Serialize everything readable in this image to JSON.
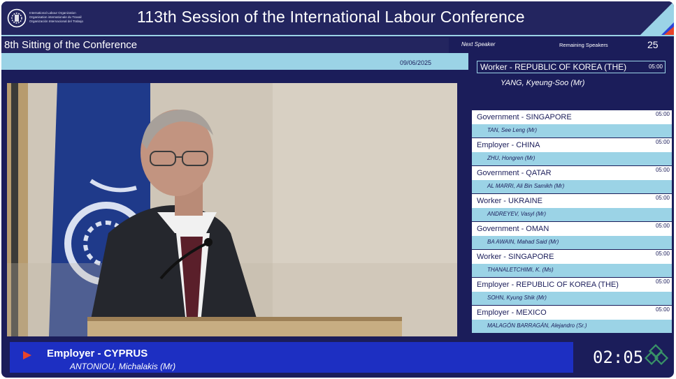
{
  "header": {
    "logo_lines": [
      "International Labour Organization",
      "Organisation internationale du Travail",
      "Organización Internacional del Trabajo"
    ],
    "title": "113th Session of the International Labour Conference"
  },
  "sitting": "8th Sitting of the Conference",
  "date": "09/06/2025",
  "next": {
    "label": "Next Speaker",
    "remaining_label": "Remaining Speakers",
    "remaining_count": "25",
    "country": "Worker - REPUBLIC OF KOREA (THE)",
    "time": "05:00",
    "name": "YANG, Kyeung-Soo (Mr)"
  },
  "speakers": [
    {
      "country": "Government - SINGAPORE",
      "name": "TAN, See Leng (Mr)",
      "time": "05:00"
    },
    {
      "country": "Employer - CHINA",
      "name": "ZHU, Hongren (Mr)",
      "time": "05:00"
    },
    {
      "country": "Government - QATAR",
      "name": "AL MARRI, Ali Bin Samikh (Mr)",
      "time": "05:00"
    },
    {
      "country": "Worker - UKRAINE",
      "name": "ANDREYEV, Vasyl (Mr)",
      "time": "05:00"
    },
    {
      "country": "Government - OMAN",
      "name": "BA AWAIN, Mahad Said (Mr)",
      "time": "05:00"
    },
    {
      "country": "Worker - SINGAPORE",
      "name": "THANALETCHIMI, K. (Ms)",
      "time": "05:00"
    },
    {
      "country": "Employer - REPUBLIC OF KOREA (THE)",
      "name": "SOHN, Kyung Shik (Mr)",
      "time": "05:00"
    },
    {
      "country": "Employer - MEXICO",
      "name": "MALAGÓN BARRAGÁN, Alejandro (Sr.)",
      "time": "05:00"
    }
  ],
  "current": {
    "country": "Employer - CYPRUS",
    "name": "ANTONIOU, Michalakis (Mr)",
    "timer": "02:05"
  },
  "colors": {
    "navy": "#1b1d5a",
    "light_blue": "#9bd3e6",
    "current_blue": "#1d2fc2",
    "play_red": "#e8442a"
  },
  "icons": {
    "emblem": "ilo-emblem-icon",
    "play": "play-icon",
    "watermark": "watermark-icon"
  }
}
